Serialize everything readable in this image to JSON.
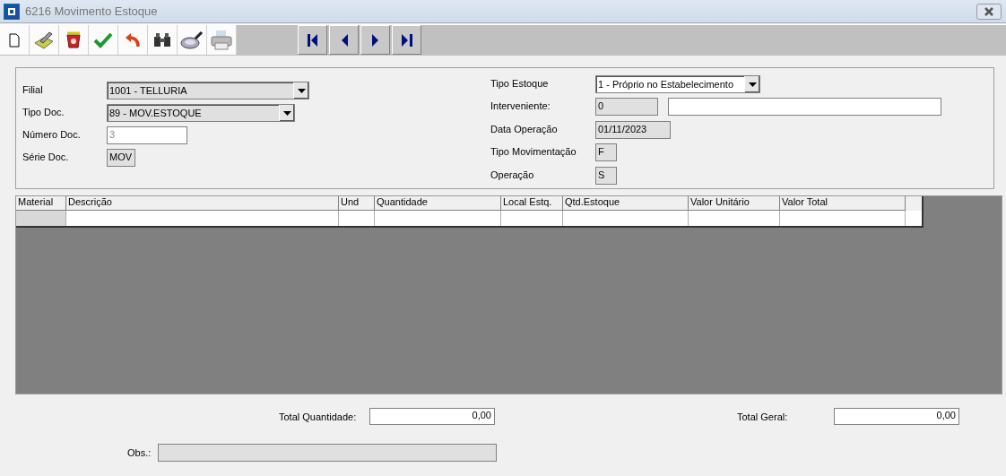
{
  "window": {
    "title": "6216 Movimento Estoque"
  },
  "form_left": [
    {
      "label": "Filial",
      "kind": "combo",
      "value": "1001 - TELLURIA"
    },
    {
      "label": "Tipo Doc.",
      "kind": "combo",
      "value": "89 - MOV.ESTOQUE"
    },
    {
      "label": "Número Doc.",
      "kind": "disabled",
      "value": "3"
    },
    {
      "label": "Série Doc.",
      "kind": "readonly",
      "value": "MOV"
    }
  ],
  "form_right": [
    {
      "label": "Tipo Estoque",
      "kind": "combo",
      "value": "1 - Próprio no Estabelecimento"
    },
    {
      "label": "Interveniente:",
      "kind": "pair",
      "value": "0"
    },
    {
      "label": "Data Operação",
      "kind": "readonly",
      "value": "01/11/2023"
    },
    {
      "label": "Tipo Movimentação",
      "kind": "readonly",
      "value": "F"
    },
    {
      "label": "Operação",
      "kind": "readonly",
      "value": "S"
    }
  ],
  "table": {
    "columns": [
      "Material",
      "Descrição",
      "Und",
      "Quantidade",
      "Local Estq.",
      "Qtd.Estoque",
      "Valor Unitário",
      "Valor Total"
    ]
  },
  "totals": [
    {
      "label": "Total Quantidade:",
      "value": "0,00"
    },
    {
      "label": "Total Geral:",
      "value": "0,00"
    }
  ],
  "obs": {
    "label": "Obs.:"
  }
}
